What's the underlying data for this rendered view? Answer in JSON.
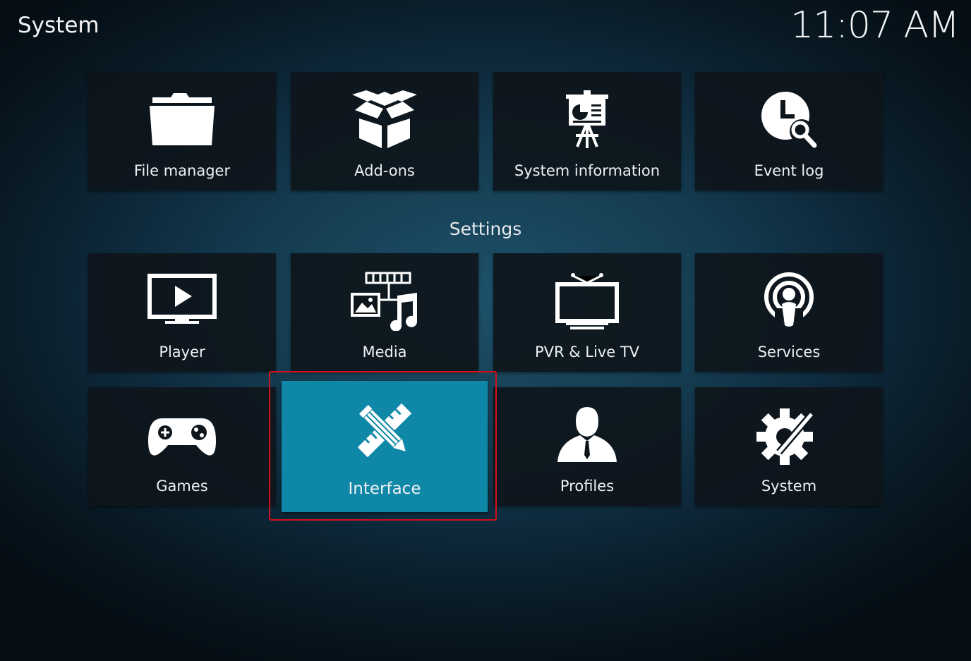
{
  "header": {
    "title": "System",
    "clock": "11:07 AM"
  },
  "tools_row": [
    {
      "label": "File manager",
      "icon": "folder-icon"
    },
    {
      "label": "Add-ons",
      "icon": "open-box-icon"
    },
    {
      "label": "System information",
      "icon": "presentation-board-icon"
    },
    {
      "label": "Event log",
      "icon": "clock-search-icon"
    }
  ],
  "settings_label": "Settings",
  "settings_row1": [
    {
      "label": "Player",
      "icon": "tv-play-icon"
    },
    {
      "label": "Media",
      "icon": "media-collage-icon"
    },
    {
      "label": "PVR & Live TV",
      "icon": "antenna-tv-icon"
    },
    {
      "label": "Services",
      "icon": "broadcast-icon"
    }
  ],
  "settings_row2": [
    {
      "label": "Games",
      "icon": "gamepad-icon"
    },
    {
      "label": "Interface",
      "icon": "pencil-ruler-icon",
      "focused": true
    },
    {
      "label": "Profiles",
      "icon": "person-icon"
    },
    {
      "label": "System",
      "icon": "gear-wrench-icon"
    }
  ],
  "colors": {
    "focus": "#0f88a8",
    "highlight": "#d3111c",
    "tile": "#0e161c"
  }
}
